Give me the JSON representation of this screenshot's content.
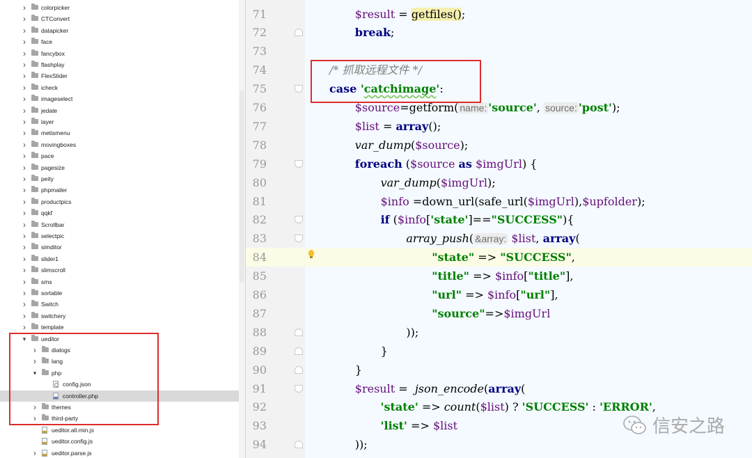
{
  "tree": {
    "items": [
      {
        "label": "colorpicker",
        "type": "folder",
        "depth": 1,
        "expanded": false
      },
      {
        "label": "CTConvert",
        "type": "folder",
        "depth": 1,
        "expanded": false
      },
      {
        "label": "datapicker",
        "type": "folder",
        "depth": 1,
        "expanded": false
      },
      {
        "label": "face",
        "type": "folder",
        "depth": 1,
        "expanded": false
      },
      {
        "label": "fancybox",
        "type": "folder",
        "depth": 1,
        "expanded": false
      },
      {
        "label": "flashplay",
        "type": "folder",
        "depth": 1,
        "expanded": false
      },
      {
        "label": "FlexSlider",
        "type": "folder",
        "depth": 1,
        "expanded": false
      },
      {
        "label": "icheck",
        "type": "folder",
        "depth": 1,
        "expanded": false
      },
      {
        "label": "imageselect",
        "type": "folder",
        "depth": 1,
        "expanded": false
      },
      {
        "label": "jedate",
        "type": "folder",
        "depth": 1,
        "expanded": false
      },
      {
        "label": "layer",
        "type": "folder",
        "depth": 1,
        "expanded": false
      },
      {
        "label": "metismenu",
        "type": "folder",
        "depth": 1,
        "expanded": false
      },
      {
        "label": "movingboxes",
        "type": "folder",
        "depth": 1,
        "expanded": false
      },
      {
        "label": "pace",
        "type": "folder",
        "depth": 1,
        "expanded": false
      },
      {
        "label": "pagesize",
        "type": "folder",
        "depth": 1,
        "expanded": false
      },
      {
        "label": "peity",
        "type": "folder",
        "depth": 1,
        "expanded": false
      },
      {
        "label": "phpmailer",
        "type": "folder",
        "depth": 1,
        "expanded": false
      },
      {
        "label": "productpics",
        "type": "folder",
        "depth": 1,
        "expanded": false
      },
      {
        "label": "qqkf",
        "type": "folder",
        "depth": 1,
        "expanded": false
      },
      {
        "label": "Scrollbar",
        "type": "folder",
        "depth": 1,
        "expanded": false
      },
      {
        "label": "selectpic",
        "type": "folder",
        "depth": 1,
        "expanded": false
      },
      {
        "label": "simditor",
        "type": "folder",
        "depth": 1,
        "expanded": false
      },
      {
        "label": "slider1",
        "type": "folder",
        "depth": 1,
        "expanded": false
      },
      {
        "label": "slimscroll",
        "type": "folder",
        "depth": 1,
        "expanded": false
      },
      {
        "label": "sms",
        "type": "folder",
        "depth": 1,
        "expanded": false
      },
      {
        "label": "sortable",
        "type": "folder",
        "depth": 1,
        "expanded": false
      },
      {
        "label": "Switch",
        "type": "folder",
        "depth": 1,
        "expanded": false
      },
      {
        "label": "switchery",
        "type": "folder",
        "depth": 1,
        "expanded": false
      },
      {
        "label": "template",
        "type": "folder",
        "depth": 1,
        "expanded": false
      },
      {
        "label": "ueditor",
        "type": "folder",
        "depth": 1,
        "expanded": true
      },
      {
        "label": "dialogs",
        "type": "folder",
        "depth": 2,
        "expanded": false
      },
      {
        "label": "lang",
        "type": "folder",
        "depth": 2,
        "expanded": false
      },
      {
        "label": "php",
        "type": "folder",
        "depth": 2,
        "expanded": true
      },
      {
        "label": "config.json",
        "type": "json",
        "depth": 3
      },
      {
        "label": "controller.php",
        "type": "php",
        "depth": 3,
        "selected": true
      },
      {
        "label": "themes",
        "type": "folder",
        "depth": 2,
        "expanded": false
      },
      {
        "label": "third-party",
        "type": "folder",
        "depth": 2,
        "expanded": false
      },
      {
        "label": "ueditor.all.min.js",
        "type": "js",
        "depth": 2
      },
      {
        "label": "ueditor.config.js",
        "type": "js",
        "depth": 2
      },
      {
        "label": "ueditor.parse.js",
        "type": "js",
        "depth": 2,
        "expanded": false
      }
    ]
  },
  "editor": {
    "current_line": "84",
    "lines": [
      {
        "num": "71",
        "fold": "",
        "tokens": [
          [
            "    ",
            ""
          ],
          [
            "$result",
            "var"
          ],
          [
            " = ",
            ""
          ],
          [
            "getfiles",
            "hl"
          ],
          [
            "()",
            "hl"
          ],
          [
            ";",
            ""
          ]
        ]
      },
      {
        "num": "72",
        "fold": "up",
        "tokens": [
          [
            "    ",
            ""
          ],
          [
            "break",
            "kw"
          ],
          [
            ";",
            ""
          ]
        ]
      },
      {
        "num": "73",
        "fold": "",
        "tokens": []
      },
      {
        "num": "74",
        "fold": "",
        "tokens": [
          [
            "/* 抓取远程文件 */",
            "cmt"
          ]
        ]
      },
      {
        "num": "75",
        "fold": "down",
        "tokens": [
          [
            "case ",
            "kw"
          ],
          [
            "'",
            "str"
          ],
          [
            "catchimage",
            "str sq"
          ],
          [
            "'",
            "str"
          ],
          [
            ":",
            ""
          ]
        ]
      },
      {
        "num": "76",
        "fold": "",
        "tokens": [
          [
            "    ",
            ""
          ],
          [
            "$source",
            "var"
          ],
          [
            "=getform(",
            ""
          ],
          [
            "name:",
            "hint"
          ],
          [
            "'source'",
            "str"
          ],
          [
            ", ",
            ""
          ],
          [
            "source:",
            "hint"
          ],
          [
            "'post'",
            "str"
          ],
          [
            ");",
            ""
          ]
        ]
      },
      {
        "num": "77",
        "fold": "",
        "tokens": [
          [
            "    ",
            ""
          ],
          [
            "$list",
            "var"
          ],
          [
            " = ",
            ""
          ],
          [
            "array",
            "kw"
          ],
          [
            "();",
            ""
          ]
        ]
      },
      {
        "num": "78",
        "fold": "",
        "tokens": [
          [
            "    ",
            ""
          ],
          [
            "var_dump",
            "it"
          ],
          [
            "(",
            ""
          ],
          [
            "$source",
            "var"
          ],
          [
            ");",
            ""
          ]
        ]
      },
      {
        "num": "79",
        "fold": "down",
        "tokens": [
          [
            "    ",
            ""
          ],
          [
            "foreach",
            "kw"
          ],
          [
            " (",
            ""
          ],
          [
            "$source",
            "var"
          ],
          [
            " ",
            ""
          ],
          [
            "as",
            "kw"
          ],
          [
            " ",
            ""
          ],
          [
            "$imgUrl",
            "var"
          ],
          [
            ") {",
            ""
          ]
        ]
      },
      {
        "num": "80",
        "fold": "",
        "tokens": [
          [
            "        ",
            ""
          ],
          [
            "var_dump",
            "it"
          ],
          [
            "(",
            ""
          ],
          [
            "$imgUrl",
            "var"
          ],
          [
            ");",
            ""
          ]
        ]
      },
      {
        "num": "81",
        "fold": "",
        "tokens": [
          [
            "        ",
            ""
          ],
          [
            "$info",
            "var"
          ],
          [
            " =down_url(safe_url(",
            ""
          ],
          [
            "$imgUrl",
            "var"
          ],
          [
            "),",
            ""
          ],
          [
            "$upfolder",
            "var"
          ],
          [
            ");",
            ""
          ]
        ]
      },
      {
        "num": "82",
        "fold": "down",
        "tokens": [
          [
            "        ",
            ""
          ],
          [
            "if",
            "kw"
          ],
          [
            " (",
            ""
          ],
          [
            "$info",
            "var"
          ],
          [
            "[",
            ""
          ],
          [
            "'state'",
            "str"
          ],
          [
            "]==",
            ""
          ],
          [
            "\"SUCCESS\"",
            "str"
          ],
          [
            "){",
            ""
          ]
        ]
      },
      {
        "num": "83",
        "fold": "down",
        "tokens": [
          [
            "            ",
            ""
          ],
          [
            "array_push",
            "it"
          ],
          [
            "(",
            ""
          ],
          [
            "&array:",
            "hint"
          ],
          [
            " ",
            ""
          ],
          [
            "$list",
            "var"
          ],
          [
            ", ",
            ""
          ],
          [
            "array",
            "kw"
          ],
          [
            "(",
            ""
          ]
        ]
      },
      {
        "num": "84",
        "fold": "",
        "tokens": [
          [
            "                ",
            ""
          ],
          [
            "\"state\"",
            "str"
          ],
          [
            " => ",
            ""
          ],
          [
            "\"SUCCESS\"",
            "str"
          ],
          [
            ",",
            ""
          ]
        ]
      },
      {
        "num": "85",
        "fold": "",
        "tokens": [
          [
            "                ",
            ""
          ],
          [
            "\"title\"",
            "str"
          ],
          [
            " => ",
            ""
          ],
          [
            "$info",
            "var"
          ],
          [
            "[",
            ""
          ],
          [
            "\"title\"",
            "str"
          ],
          [
            "],",
            ""
          ]
        ]
      },
      {
        "num": "86",
        "fold": "",
        "tokens": [
          [
            "                ",
            ""
          ],
          [
            "\"url\"",
            "str"
          ],
          [
            " => ",
            ""
          ],
          [
            "$info",
            "var"
          ],
          [
            "[",
            ""
          ],
          [
            "\"url\"",
            "str"
          ],
          [
            "],",
            ""
          ]
        ]
      },
      {
        "num": "87",
        "fold": "",
        "tokens": [
          [
            "                ",
            ""
          ],
          [
            "\"source\"",
            "str"
          ],
          [
            "=>",
            ""
          ],
          [
            "$imgUrl",
            "var"
          ]
        ]
      },
      {
        "num": "88",
        "fold": "up",
        "tokens": [
          [
            "            ",
            ""
          ],
          [
            "));",
            ""
          ]
        ]
      },
      {
        "num": "89",
        "fold": "up",
        "tokens": [
          [
            "        ",
            ""
          ],
          [
            "}",
            ""
          ]
        ]
      },
      {
        "num": "90",
        "fold": "up",
        "tokens": [
          [
            "    ",
            ""
          ],
          [
            "}",
            ""
          ]
        ]
      },
      {
        "num": "91",
        "fold": "down",
        "tokens": [
          [
            "    ",
            ""
          ],
          [
            "$result",
            "var"
          ],
          [
            " =  ",
            ""
          ],
          [
            "json_encode",
            "it"
          ],
          [
            "(",
            ""
          ],
          [
            "array",
            "kw"
          ],
          [
            "(",
            ""
          ]
        ]
      },
      {
        "num": "92",
        "fold": "",
        "tokens": [
          [
            "        ",
            ""
          ],
          [
            "'state'",
            "str"
          ],
          [
            " => ",
            ""
          ],
          [
            "count",
            "it"
          ],
          [
            "(",
            ""
          ],
          [
            "$list",
            "var"
          ],
          [
            ") ? ",
            ""
          ],
          [
            "'SUCCESS'",
            "str"
          ],
          [
            " : ",
            ""
          ],
          [
            "'ERROR'",
            "str"
          ],
          [
            ",",
            ""
          ]
        ]
      },
      {
        "num": "93",
        "fold": "",
        "tokens": [
          [
            "        ",
            ""
          ],
          [
            "'list'",
            "str"
          ],
          [
            " => ",
            ""
          ],
          [
            "$list",
            "var"
          ]
        ]
      },
      {
        "num": "94",
        "fold": "up",
        "tokens": [
          [
            "    ",
            ""
          ],
          [
            "));",
            ""
          ]
        ]
      }
    ]
  },
  "watermark": {
    "text": "信安之路",
    "icon": "wechat-icon"
  },
  "colors": {
    "highlight_box": "#e02a2a",
    "variable": "#660e7a",
    "keyword": "#000080",
    "string": "#008000",
    "comment": "#808080"
  }
}
